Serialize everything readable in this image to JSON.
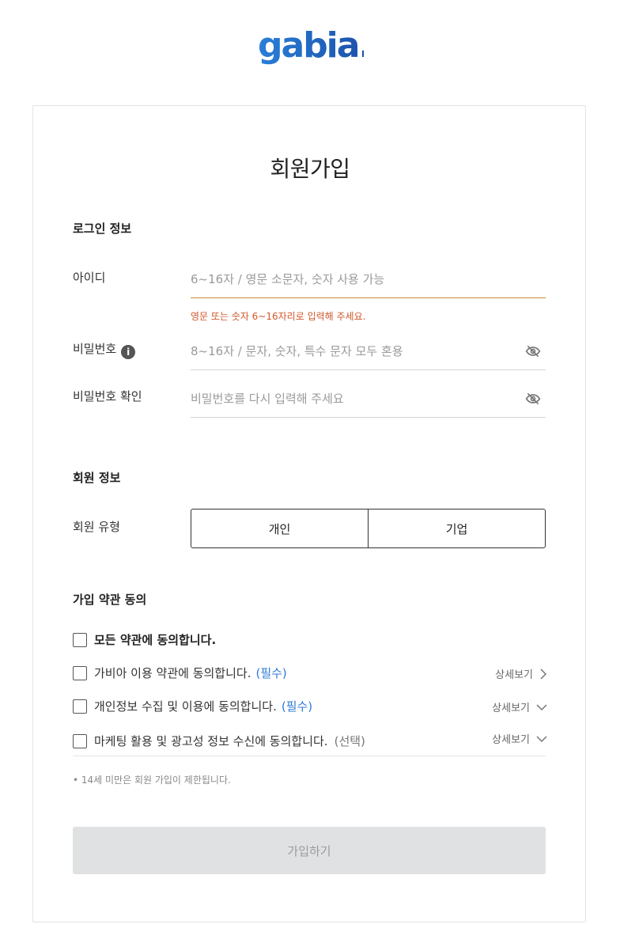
{
  "brand": {
    "logo_text": "gabia.",
    "logo_color": "#1f6fd1"
  },
  "page": {
    "title": "회원가입"
  },
  "login_info": {
    "section_title": "로그인 정보",
    "id": {
      "label": "아이디",
      "placeholder": "6~16자 / 영문 소문자, 숫자 사용 가능",
      "value": "",
      "error": "영문 또는 숫자 6~16자리로 입력해 주세요."
    },
    "password": {
      "label": "비밀번호",
      "info_icon": "i",
      "placeholder": "8~16자 / 문자, 숫자, 특수 문자 모두 혼용",
      "value": ""
    },
    "password_confirm": {
      "label": "비밀번호 확인",
      "placeholder": "비밀번호를 다시 입력해 주세요",
      "value": ""
    }
  },
  "member_info": {
    "section_title": "회원 정보",
    "type_label": "회원 유형",
    "types": [
      "개인",
      "기업"
    ]
  },
  "terms": {
    "section_title": "가입 약관 동의",
    "all_label": "모든 약관에 동의합니다.",
    "items": [
      {
        "label": "가비아 이용 약관에 동의합니다.",
        "tag": "(필수)",
        "detail": "상세보기",
        "chevron": "chevron-right"
      },
      {
        "label": "개인정보 수집 및 이용에 동의합니다.",
        "tag": "(필수)",
        "detail": "상세보기",
        "chevron": "chevron-down"
      },
      {
        "label": "마케팅 활용 및 광고성 정보 수신에 동의합니다.",
        "tag": "(선택)",
        "detail": "상세보기",
        "chevron": "chevron-down"
      }
    ],
    "note": "• 14세 미만은 회원 가입이 제한됩니다."
  },
  "submit": {
    "label": "가입하기"
  },
  "colors": {
    "required_tag": "#2f7bd6",
    "error_text": "#d0582a",
    "error_border": "#c9893a",
    "submit_bg": "#e0e1e3"
  }
}
